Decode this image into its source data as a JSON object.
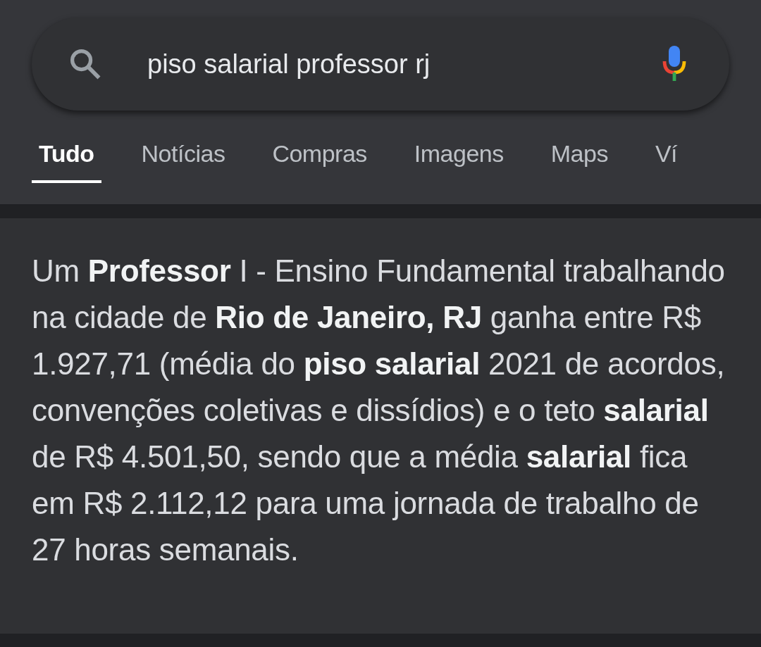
{
  "search": {
    "value": "piso salarial professor rj"
  },
  "tabs": [
    {
      "label": "Tudo",
      "selected": true
    },
    {
      "label": "Notícias",
      "selected": false
    },
    {
      "label": "Compras",
      "selected": false
    },
    {
      "label": "Imagens",
      "selected": false
    },
    {
      "label": "Maps",
      "selected": false
    },
    {
      "label": "Ví",
      "selected": false
    }
  ],
  "snippet": "Um **Professor** I - Ensino Fundamental trabalhando na cidade de **Rio de Janeiro, RJ** ganha entre R$ 1.927,71 (média do **piso salarial** 2021 de acordos, convenções coletivas e dissídios) e o teto **salarial** de R$ 4.501,50, sendo que a média **salarial** fica em R$ 2.112,12 para uma jornada de trabalho de 27 horas semanais."
}
